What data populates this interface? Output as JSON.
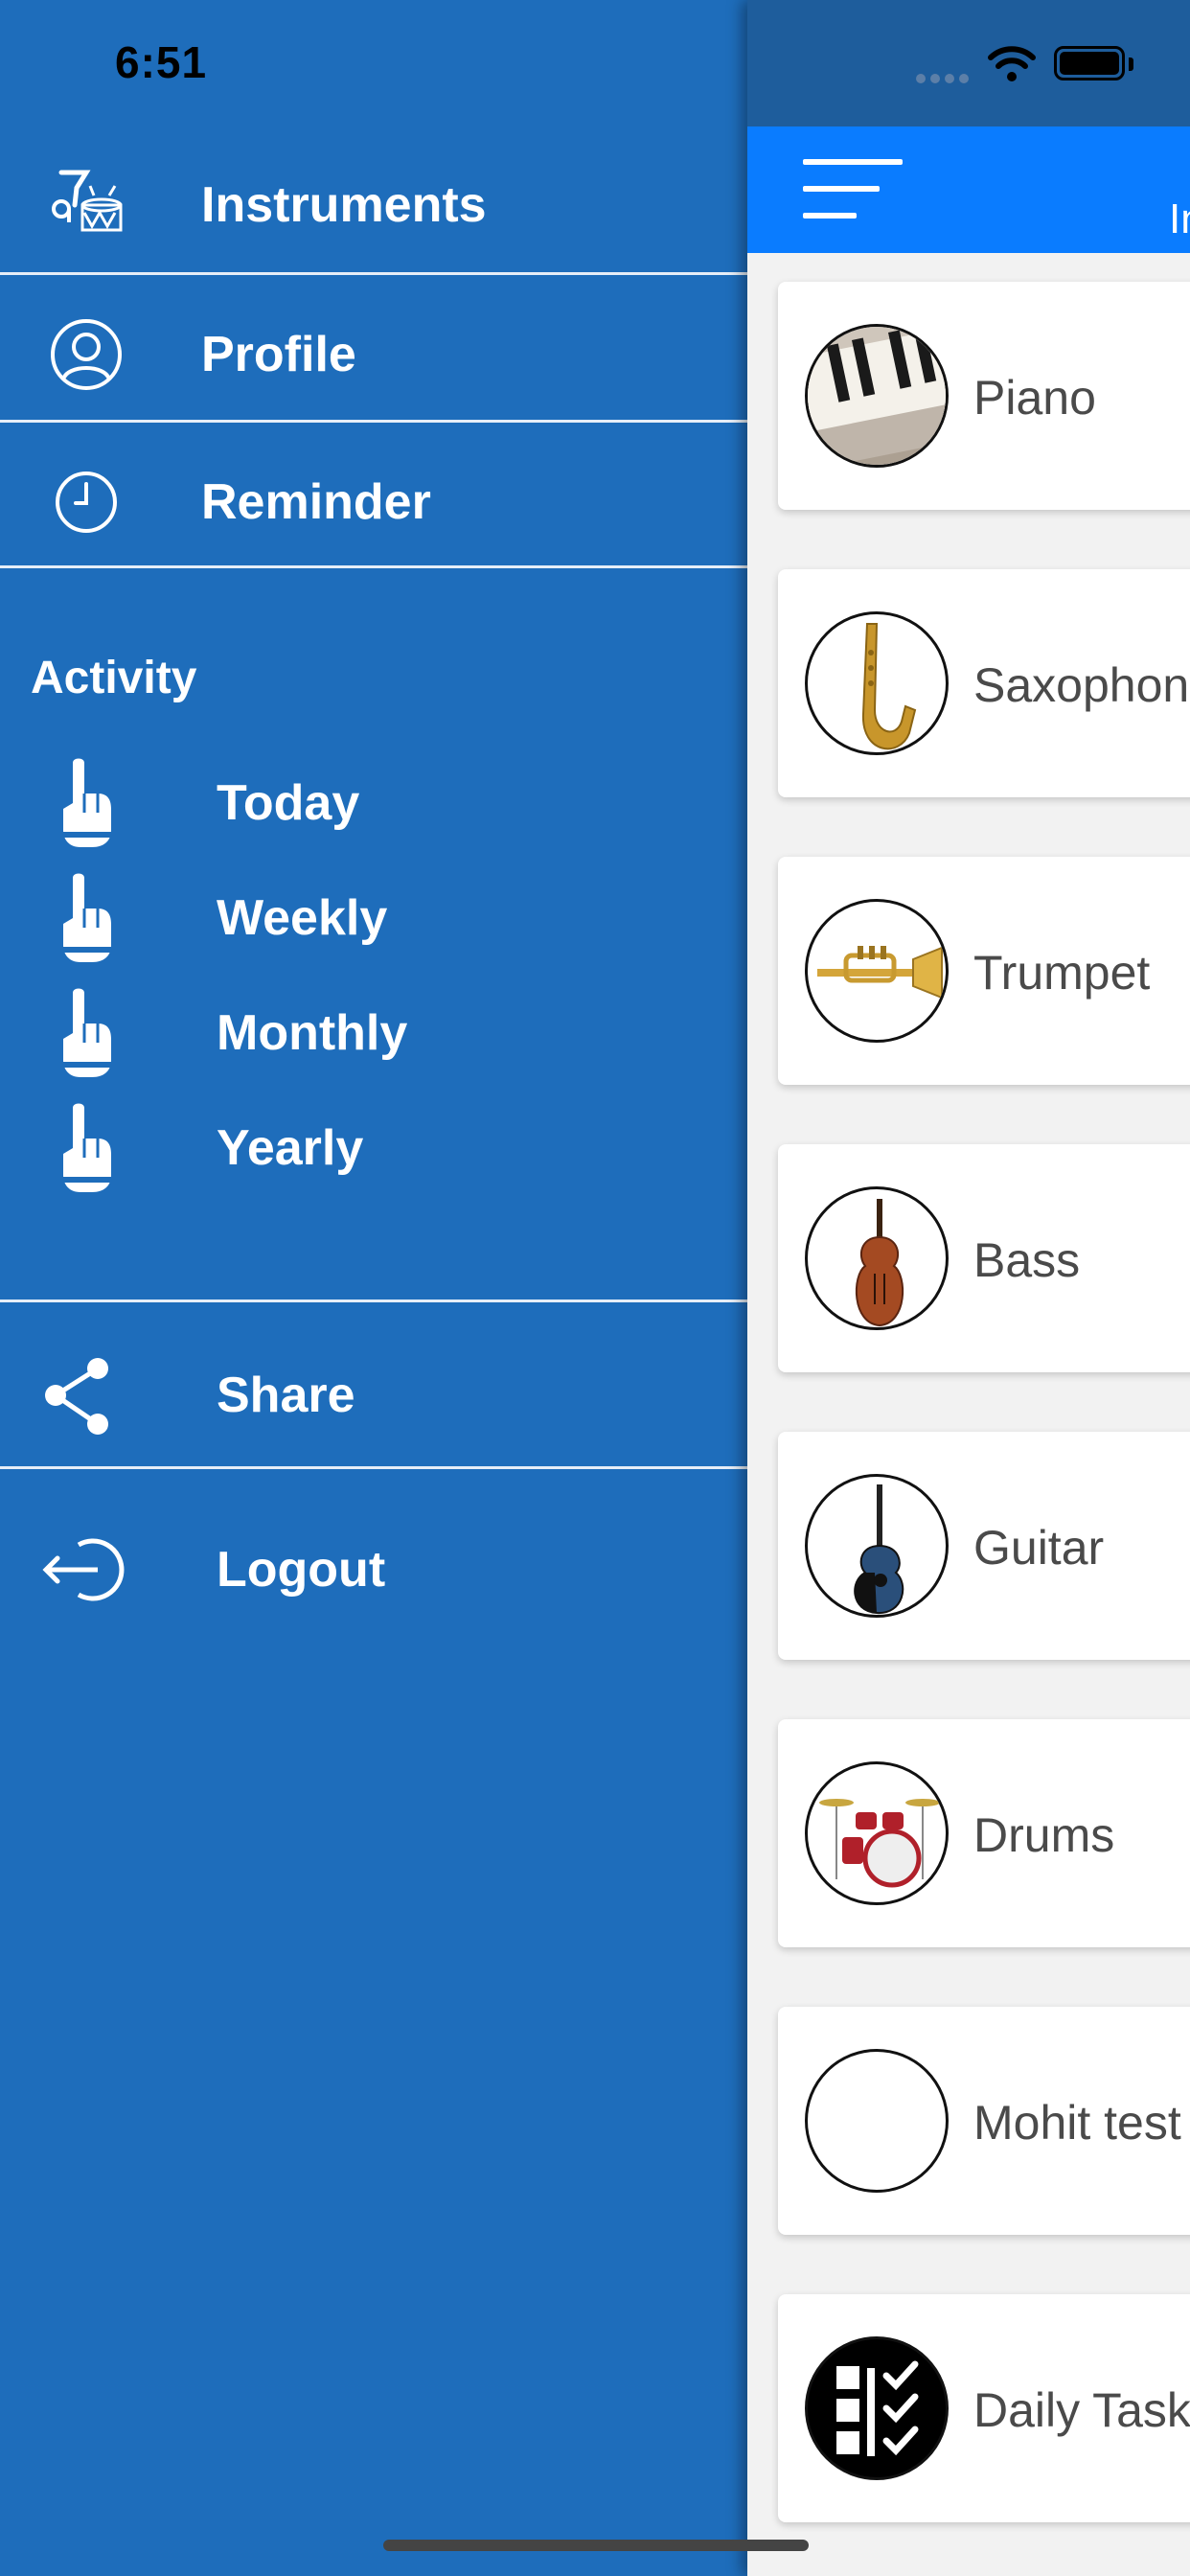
{
  "status_bar": {
    "time": "6:51"
  },
  "drawer": {
    "top_items": [
      {
        "label": "Instruments",
        "icon": "instruments-icon"
      },
      {
        "label": "Profile",
        "icon": "user-icon"
      },
      {
        "label": "Reminder",
        "icon": "clock-icon"
      }
    ],
    "activity_title": "Activity",
    "activity_items": [
      {
        "label": "Today",
        "icon": "hand-pointer-icon"
      },
      {
        "label": "Weekly",
        "icon": "hand-pointer-icon"
      },
      {
        "label": "Monthly",
        "icon": "hand-pointer-icon"
      },
      {
        "label": "Yearly",
        "icon": "hand-pointer-icon"
      }
    ],
    "bottom_items": [
      {
        "label": "Share",
        "icon": "share-icon"
      },
      {
        "label": "Logout",
        "icon": "logout-icon"
      }
    ]
  },
  "main": {
    "header_title": "In",
    "menu_icon": "hamburger-icon",
    "instruments": [
      {
        "name": "Piano",
        "image": "piano"
      },
      {
        "name": "Saxophon",
        "image": "saxophone"
      },
      {
        "name": "Trumpet",
        "image": "trumpet"
      },
      {
        "name": "Bass",
        "image": "bass"
      },
      {
        "name": "Guitar",
        "image": "guitar"
      },
      {
        "name": "Drums",
        "image": "drums"
      },
      {
        "name": "Mohit test",
        "image": "empty"
      },
      {
        "name": "Daily Task",
        "image": "checklist"
      }
    ]
  },
  "colors": {
    "drawer_bg": "#1e6dbb",
    "header_bg": "#0a7cff",
    "main_status_bg": "#1e5d9c",
    "card_bg": "#ffffff",
    "card_text": "#4a4a4a"
  }
}
